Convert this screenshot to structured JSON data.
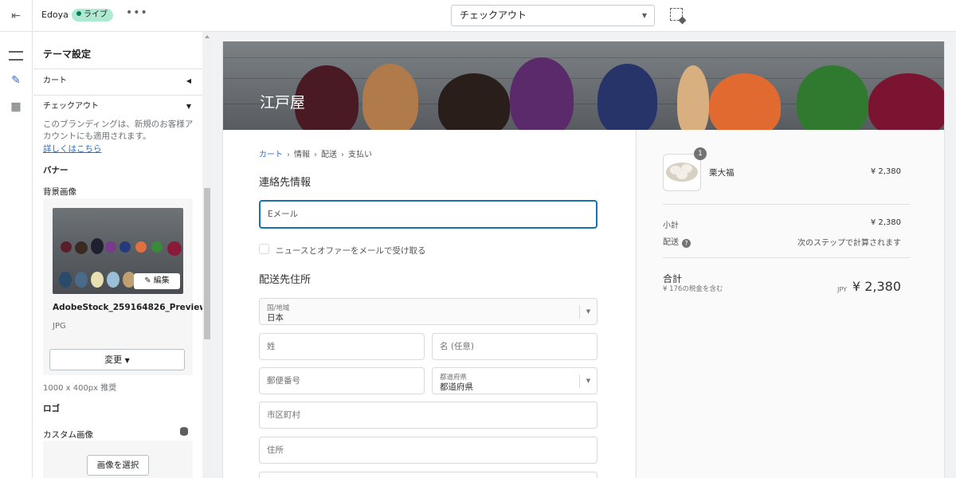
{
  "topbar": {
    "store_name": "Edoya",
    "status_badge": "ライブ",
    "more": "•••",
    "page_select": "チェックアウト"
  },
  "panel": {
    "title": "テーマ設定",
    "cart_label": "カート",
    "checkout_label": "チェックアウト",
    "description": "このブランディングは、新規のお客様アカウントにも適用されます。",
    "learn_more": "詳しくはこちら",
    "banner_heading": "バナー",
    "bg_image_label": "背景画像",
    "edit_label": "編集",
    "file_name": "AdobeStock_259164826_Preview",
    "file_type": "JPG",
    "change_label": "変更",
    "size_hint": "1000 x 400px 推奨",
    "logo_heading": "ロゴ",
    "custom_image_label": "カスタム画像",
    "select_image_label": "画像を選択"
  },
  "checkout": {
    "shop_name": "江戸屋",
    "breadcrumb": [
      "カート",
      "情報",
      "配送",
      "支払い"
    ],
    "contact_heading": "連絡先情報",
    "email_placeholder": "Eメール",
    "newsletter_label": "ニュースとオファーをメールで受け取る",
    "shipping_heading": "配送先住所",
    "country_caption": "国/地域",
    "country_value": "日本",
    "last_name": "姓",
    "first_name": "名 (任意)",
    "postal_code": "郵便番号",
    "prefecture_caption": "都道府県",
    "prefecture_value": "都道府県",
    "city": "市区町村",
    "address": "住所"
  },
  "summary": {
    "quantity": "1",
    "product_name": "栗大福",
    "product_price": "¥ 2,380",
    "subtotal_label": "小計",
    "subtotal_value": "¥ 2,380",
    "shipping_label": "配送",
    "shipping_value": "次のステップで計算されます",
    "total_label": "合計",
    "tax_note": "¥ 176の税金を含む",
    "currency": "JPY",
    "total_value": "¥ 2,380"
  },
  "colors": {
    "accent": "#2c6ecb",
    "live_badge": "#aee9d1",
    "focus": "#1773b0"
  }
}
